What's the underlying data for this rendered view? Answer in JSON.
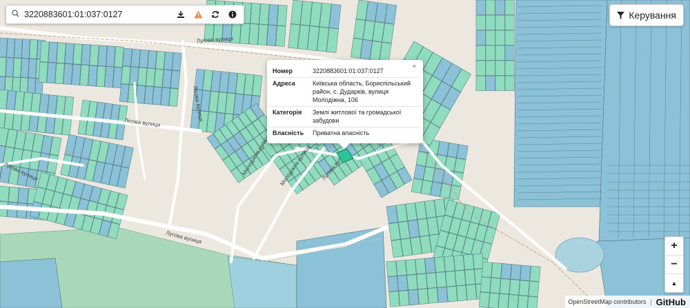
{
  "search": {
    "value": "3220883601:01:037:0127"
  },
  "toolbar": {
    "search_icon": "search-icon",
    "tools": [
      {
        "name": "download-icon",
        "glyph": "download"
      },
      {
        "name": "warning-icon",
        "glyph": "warning"
      },
      {
        "name": "refresh-icon",
        "glyph": "refresh"
      },
      {
        "name": "info-icon",
        "glyph": "info"
      }
    ]
  },
  "control_button": {
    "label": "Керування",
    "icon": "filter-icon"
  },
  "popup": {
    "close": "×",
    "rows": [
      {
        "key": "Номер",
        "value": "3220883601:01:037:0127"
      },
      {
        "key": "Адреса",
        "value": "Київська область, Бориспільський район, с. Дударків, вулиця Молодіжна, 106"
      },
      {
        "key": "Категорія",
        "value": "Землі житлової та громадської забудови"
      },
      {
        "key": "Власність",
        "value": "Приватна власність"
      }
    ]
  },
  "street_labels": [
    {
      "text": "Лугова вулиця"
    },
    {
      "text": "Лісова вулиця"
    },
    {
      "text": "Лісова вулиця"
    },
    {
      "text": "Лугова вулиця"
    },
    {
      "text": "Молодіжна вулиця"
    },
    {
      "text": "Молодіжна вулиця"
    },
    {
      "text": "Лугова вулиця"
    },
    {
      "text": "Лугова вулиця"
    }
  ],
  "zoom": {
    "in": "+",
    "out": "−",
    "north": "▲"
  },
  "attribution": {
    "osm": "OpenStreetMap contributors",
    "separator": "|",
    "github": "GitHub"
  },
  "colors": {
    "land": "#ece8e0",
    "field": "#a8d8b8",
    "parcel_green": "#8fdcbe",
    "parcel_blue": "#8cc2d8",
    "parcel_stroke": "#4a6f78",
    "road": "#ffffff",
    "water": "#aad3df",
    "accent_warning": "#f08a3c"
  }
}
